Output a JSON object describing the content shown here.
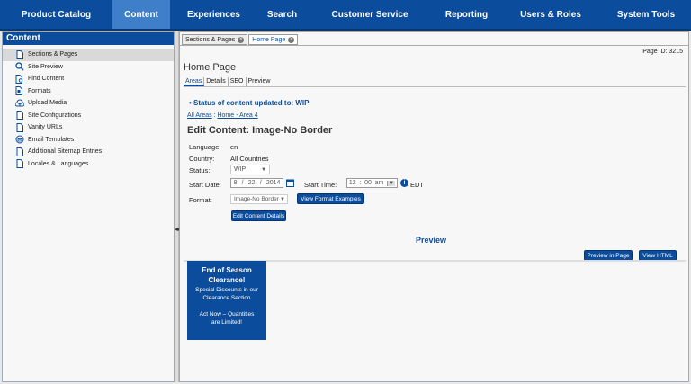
{
  "topnav": [
    {
      "label": "Product Catalog",
      "active": false
    },
    {
      "label": "Content",
      "active": true
    },
    {
      "label": "Experiences",
      "active": false
    },
    {
      "label": "Search",
      "active": false
    },
    {
      "label": "Customer Service",
      "active": false
    },
    {
      "label": "Reporting",
      "active": false
    },
    {
      "label": "Users & Roles",
      "active": false
    },
    {
      "label": "System Tools",
      "active": false
    }
  ],
  "sidebar": {
    "title": "Content",
    "items": [
      {
        "label": "Sections & Pages",
        "icon": "page-icon",
        "active": true
      },
      {
        "label": "Site Preview",
        "icon": "magnifier-icon",
        "active": false
      },
      {
        "label": "Find Content",
        "icon": "find-page-icon",
        "active": false
      },
      {
        "label": "Formats",
        "icon": "format-icon",
        "active": false
      },
      {
        "label": "Upload Media",
        "icon": "upload-cloud-icon",
        "active": false
      },
      {
        "label": "Site Configurations",
        "icon": "page-icon",
        "active": false
      },
      {
        "label": "Vanity URLs",
        "icon": "page-icon",
        "active": false
      },
      {
        "label": "Email Templates",
        "icon": "email-icon",
        "active": false
      },
      {
        "label": "Additional Sitemap Entries",
        "icon": "page-icon",
        "active": false
      },
      {
        "label": "Locales & Languages",
        "icon": "page-icon",
        "active": false
      }
    ]
  },
  "tabs": [
    {
      "label": "Sections & Pages",
      "active": false
    },
    {
      "label": "Home Page",
      "active": true
    }
  ],
  "page": {
    "id_label": "Page ID: 3215",
    "title": "Home Page",
    "subtabs": [
      "Areas",
      "Details",
      "SEO",
      "Preview"
    ],
    "status_message": "• Status of content updated to: WIP",
    "breadcrumb": [
      "All Areas",
      "Home - Area 4"
    ],
    "breadcrumb_sep": " : "
  },
  "edit": {
    "title": "Edit Content: Image-No Border",
    "language_label": "Language:",
    "language_value": "en",
    "country_label": "Country:",
    "country_value": "All Countries",
    "status_label": "Status:",
    "status_value": "WIP",
    "start_date_label": "Start Date:",
    "start_date": {
      "month": "8",
      "day": "22",
      "year": "2014"
    },
    "start_time_label": "Start Time:",
    "start_time": {
      "hour": "12",
      "minute": "00",
      "ampm": "am"
    },
    "timezone": "EDT",
    "format_label": "Format:",
    "format_value": "Image-No Border",
    "view_format_button": "View Format Examples",
    "edit_details_button": "Edit Content Details"
  },
  "preview": {
    "title": "Preview",
    "preview_in_page_button": "Preview in Page",
    "view_html_button": "View HTML",
    "promo": {
      "heading_line1": "End of Season",
      "heading_line2": "Clearance!",
      "sub_line1": "Special Discounts in our",
      "sub_line2": "Clearance Section",
      "cta_line1": "Act Now – Quantities",
      "cta_line2": "are Limited!"
    }
  },
  "colors": {
    "brand": "#0b4d9c",
    "nav_active": "#3f7fc9"
  }
}
